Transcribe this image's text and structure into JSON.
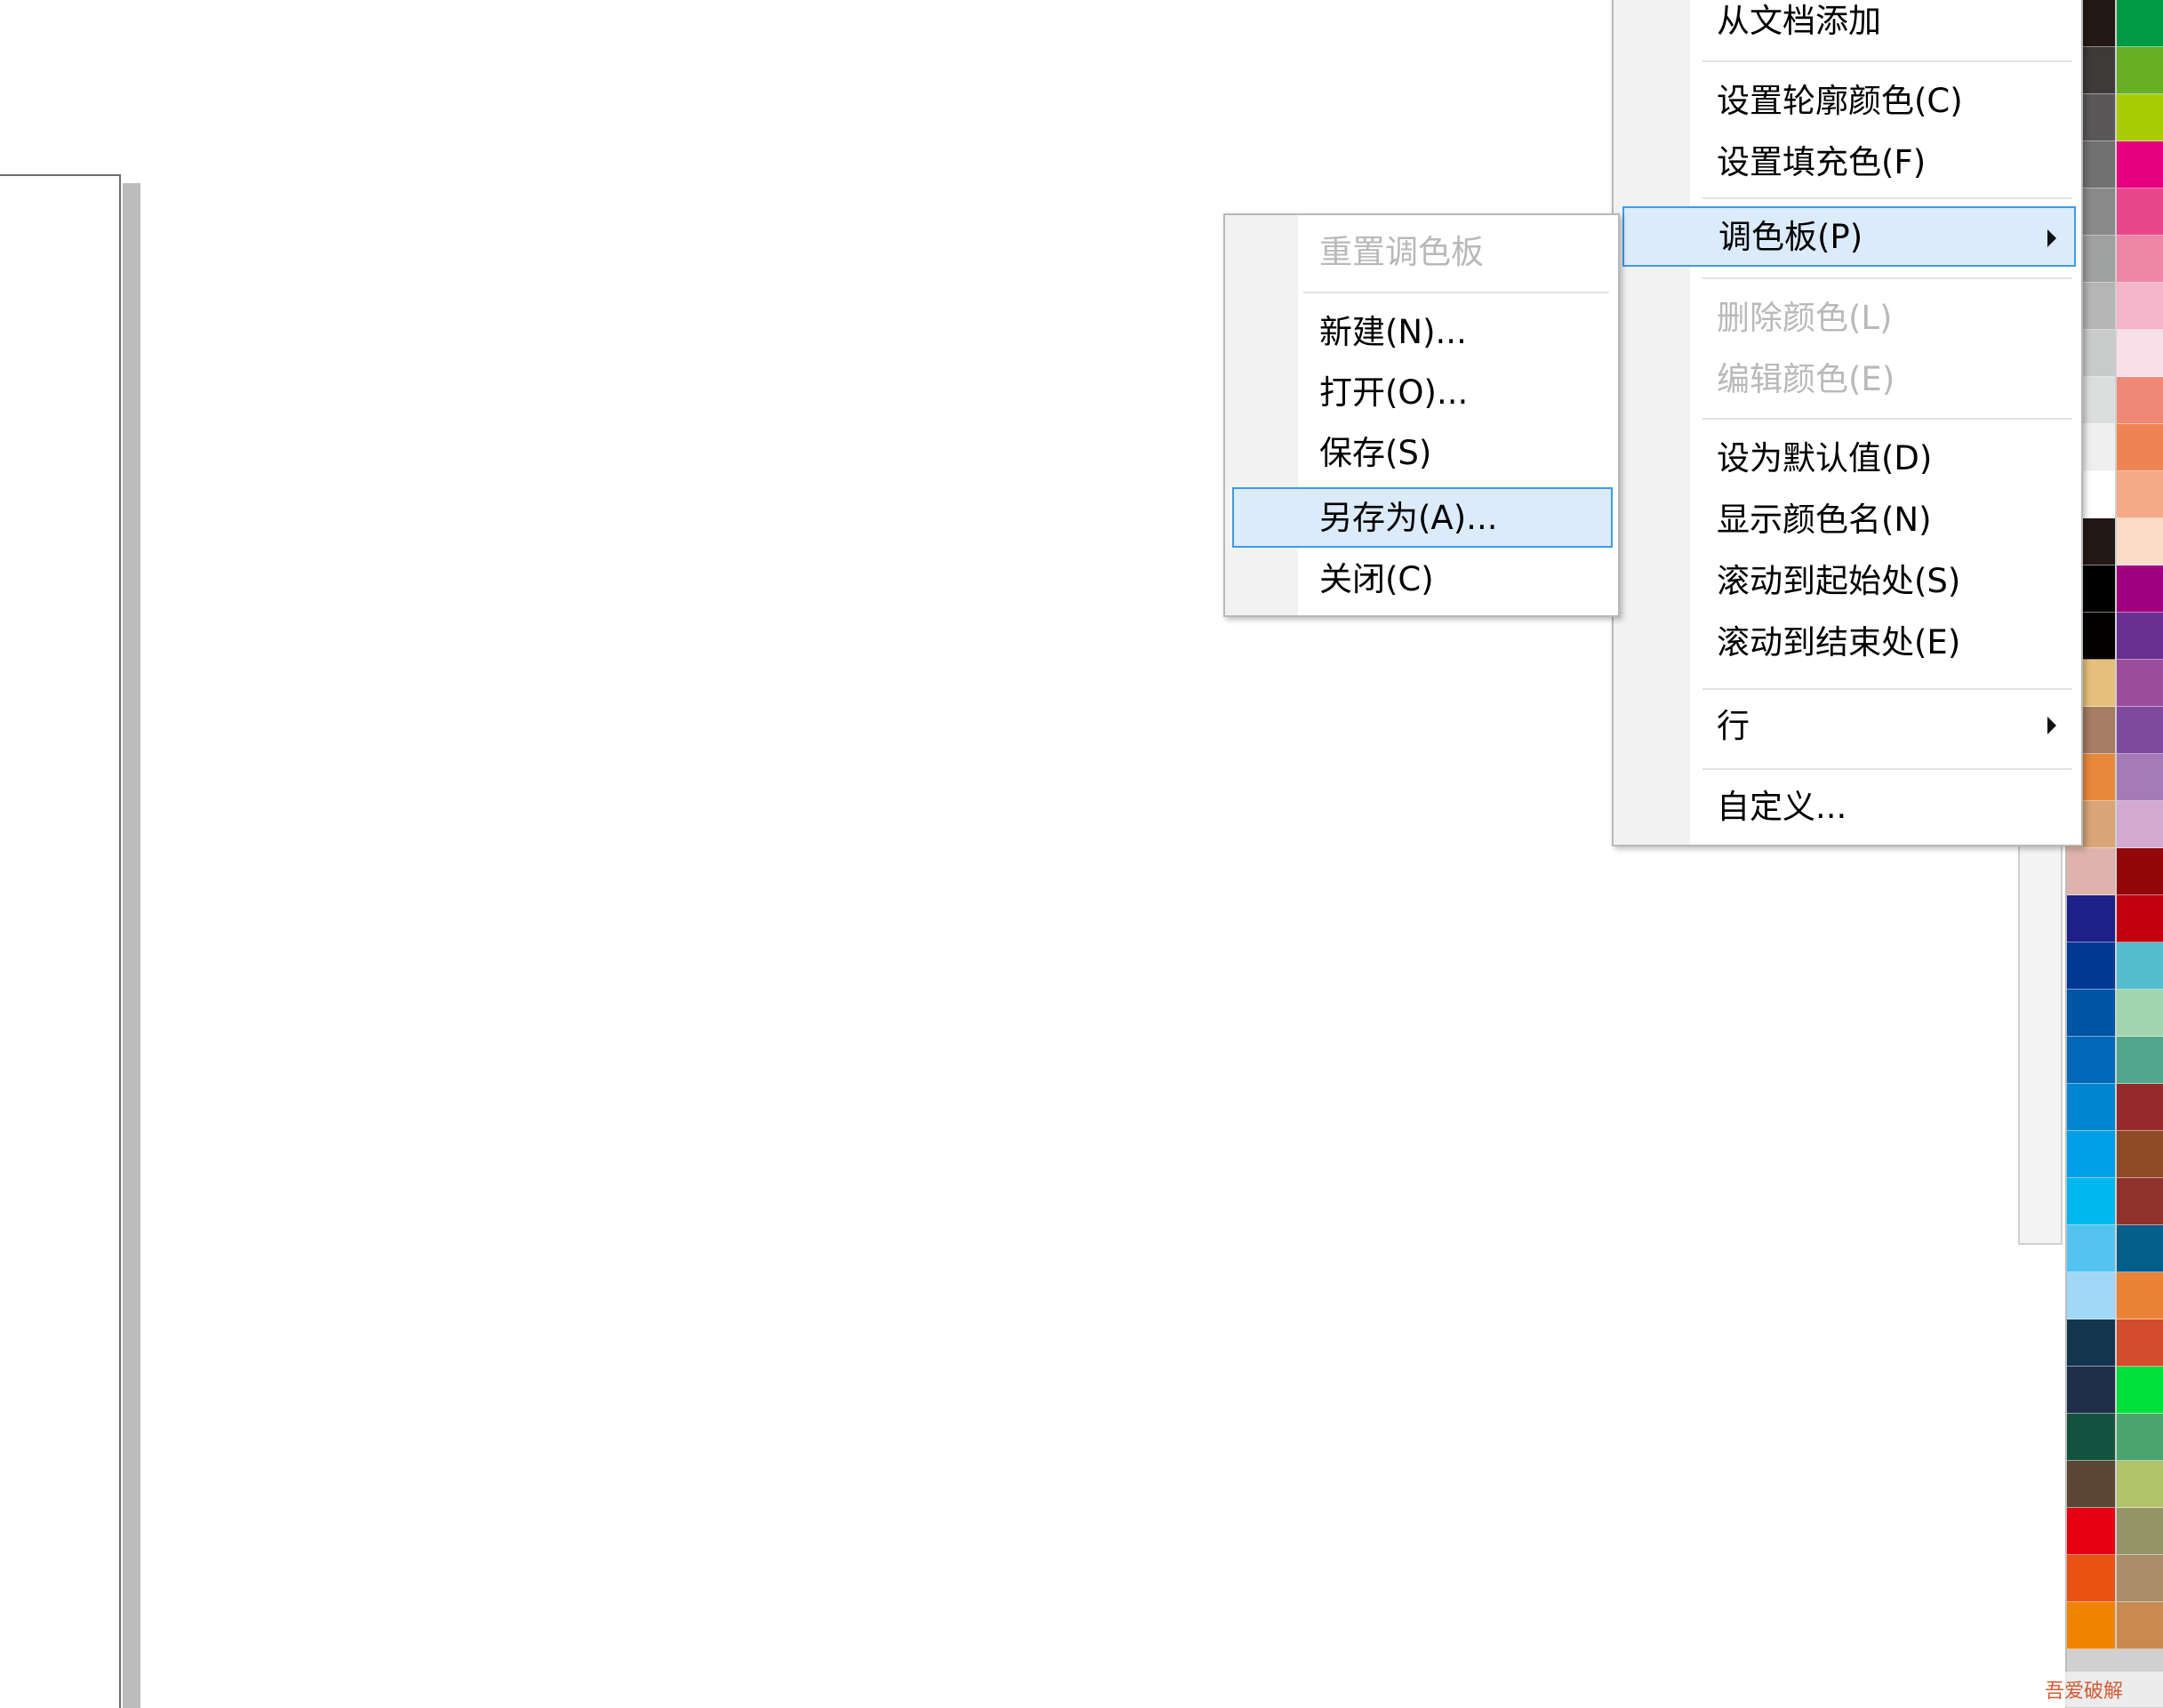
{
  "main_menu": {
    "items": [
      {
        "label": "从文档添加",
        "enabled": true
      },
      {
        "label": "设置轮廓颜色(C)",
        "enabled": true
      },
      {
        "label": "设置填充色(F)",
        "enabled": true
      },
      {
        "label": "调色板(P)",
        "enabled": true,
        "highlighted": true,
        "submenu": true
      },
      {
        "label": "删除颜色(L)",
        "enabled": false
      },
      {
        "label": "编辑颜色(E)",
        "enabled": false
      },
      {
        "label": "设为默认值(D)",
        "enabled": true
      },
      {
        "label": "显示颜色名(N)",
        "enabled": true
      },
      {
        "label": "滚动到起始处(S)",
        "enabled": true
      },
      {
        "label": "滚动到结束处(E)",
        "enabled": true
      },
      {
        "label": "行",
        "enabled": true,
        "submenu": true
      },
      {
        "label": "自定义...",
        "enabled": true
      }
    ]
  },
  "palette_submenu": {
    "items": [
      {
        "label": "重置调色板",
        "enabled": false
      },
      {
        "label": "新建(N)...",
        "enabled": true
      },
      {
        "label": "打开(O)...",
        "enabled": true
      },
      {
        "label": "保存(S)",
        "enabled": true
      },
      {
        "label": "另存为(A)...",
        "enabled": true,
        "highlighted": true
      },
      {
        "label": "关闭(C)",
        "enabled": true
      }
    ]
  },
  "palette": {
    "left_column": [
      "#231815",
      "#3e3a39",
      "#595757",
      "#727171",
      "#898989",
      "#9fa0a0",
      "#b5b5b6",
      "#c9caca",
      "#dcdddd",
      "#efefef",
      "#ffffff",
      "#231815",
      "#000000",
      "#040000",
      "#e5c07b",
      "#a57c64",
      "#e8883a",
      "#d8a478",
      "#dfb2ac",
      "#1d2088",
      "#003894",
      "#0054a6",
      "#0068b7",
      "#0086d1",
      "#009fe8",
      "#00b7ee",
      "#54c3f1",
      "#a0d8f5",
      "#14354e",
      "#1f2f4a",
      "#14533f",
      "#5c4634",
      "#e60012",
      "#e85313",
      "#f08300"
    ],
    "right_column": [
      "#009944",
      "#67b026",
      "#aacc03",
      "#e4007f",
      "#e8478b",
      "#ee86a8",
      "#f4b4c9",
      "#f9dfe8",
      "#ef8874",
      "#ef8354",
      "#f5a986",
      "#fbdcc8",
      "#a0007d",
      "#6a3090",
      "#9c4c9a",
      "#7d4a9d",
      "#a57bb7",
      "#d2a9d0",
      "#93060a",
      "#c3000d",
      "#53bccf",
      "#a1d5ae",
      "#52a68d",
      "#96292a",
      "#8f4a28",
      "#91312b",
      "#035e8a",
      "#eb8336",
      "#d34c2c",
      "#00e23a",
      "#4ca56f",
      "#b3c36a",
      "#939568",
      "#aa8e6a",
      "#c98a50"
    ]
  },
  "watermark": {
    "text": "吾爱破解"
  }
}
